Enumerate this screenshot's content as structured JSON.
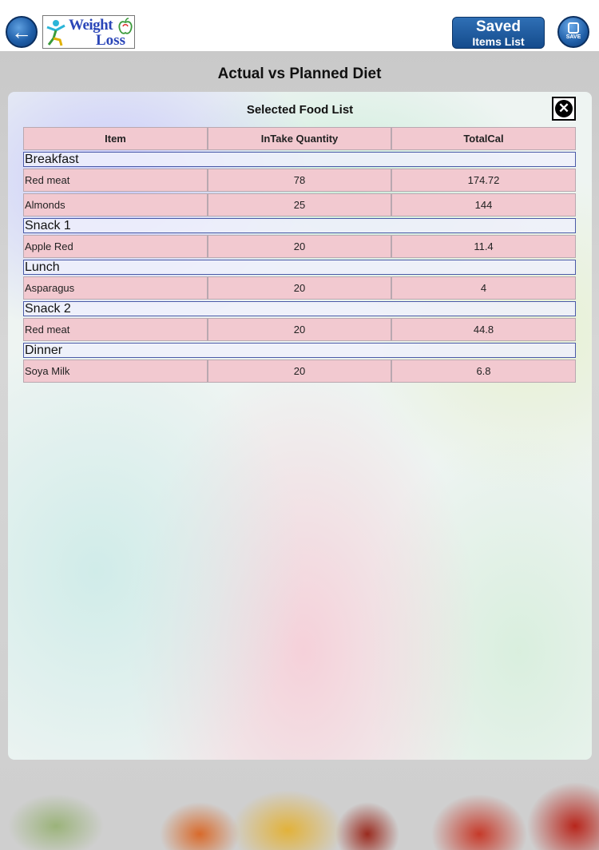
{
  "header": {
    "back_icon": "arrow-left-icon",
    "logo": {
      "line1": "Weight",
      "line2": "Loss"
    },
    "saved_button": {
      "line1": "Saved",
      "line2": "Items List"
    },
    "save_button": {
      "icon": "floppy-disk-icon",
      "label": "SAVE"
    }
  },
  "page": {
    "title": "Actual vs Planned Diet"
  },
  "popup": {
    "title": "Selected Food List",
    "close_icon": "close-icon",
    "columns": [
      "Item",
      "InTake Quantity",
      "TotalCal"
    ],
    "sections": [
      {
        "name": "Breakfast",
        "rows": [
          {
            "item": "Red meat",
            "qty": "78",
            "cal": "174.72"
          },
          {
            "item": "Almonds",
            "qty": "25",
            "cal": "144"
          }
        ]
      },
      {
        "name": "Snack 1",
        "rows": [
          {
            "item": "Apple Red",
            "qty": "20",
            "cal": "11.4"
          }
        ]
      },
      {
        "name": "Lunch",
        "rows": [
          {
            "item": "Asparagus",
            "qty": "20",
            "cal": "4"
          }
        ]
      },
      {
        "name": "Snack 2",
        "rows": [
          {
            "item": "Red meat",
            "qty": "20",
            "cal": "44.8"
          }
        ]
      },
      {
        "name": "Dinner",
        "rows": [
          {
            "item": "Soya Milk",
            "qty": "20",
            "cal": "6.8"
          }
        ]
      }
    ]
  },
  "colors": {
    "header_bg": "#ffffff",
    "button_blue": "#144b8c",
    "table_cell": "#f2c9d0",
    "section_border": "#4a5aa8"
  }
}
